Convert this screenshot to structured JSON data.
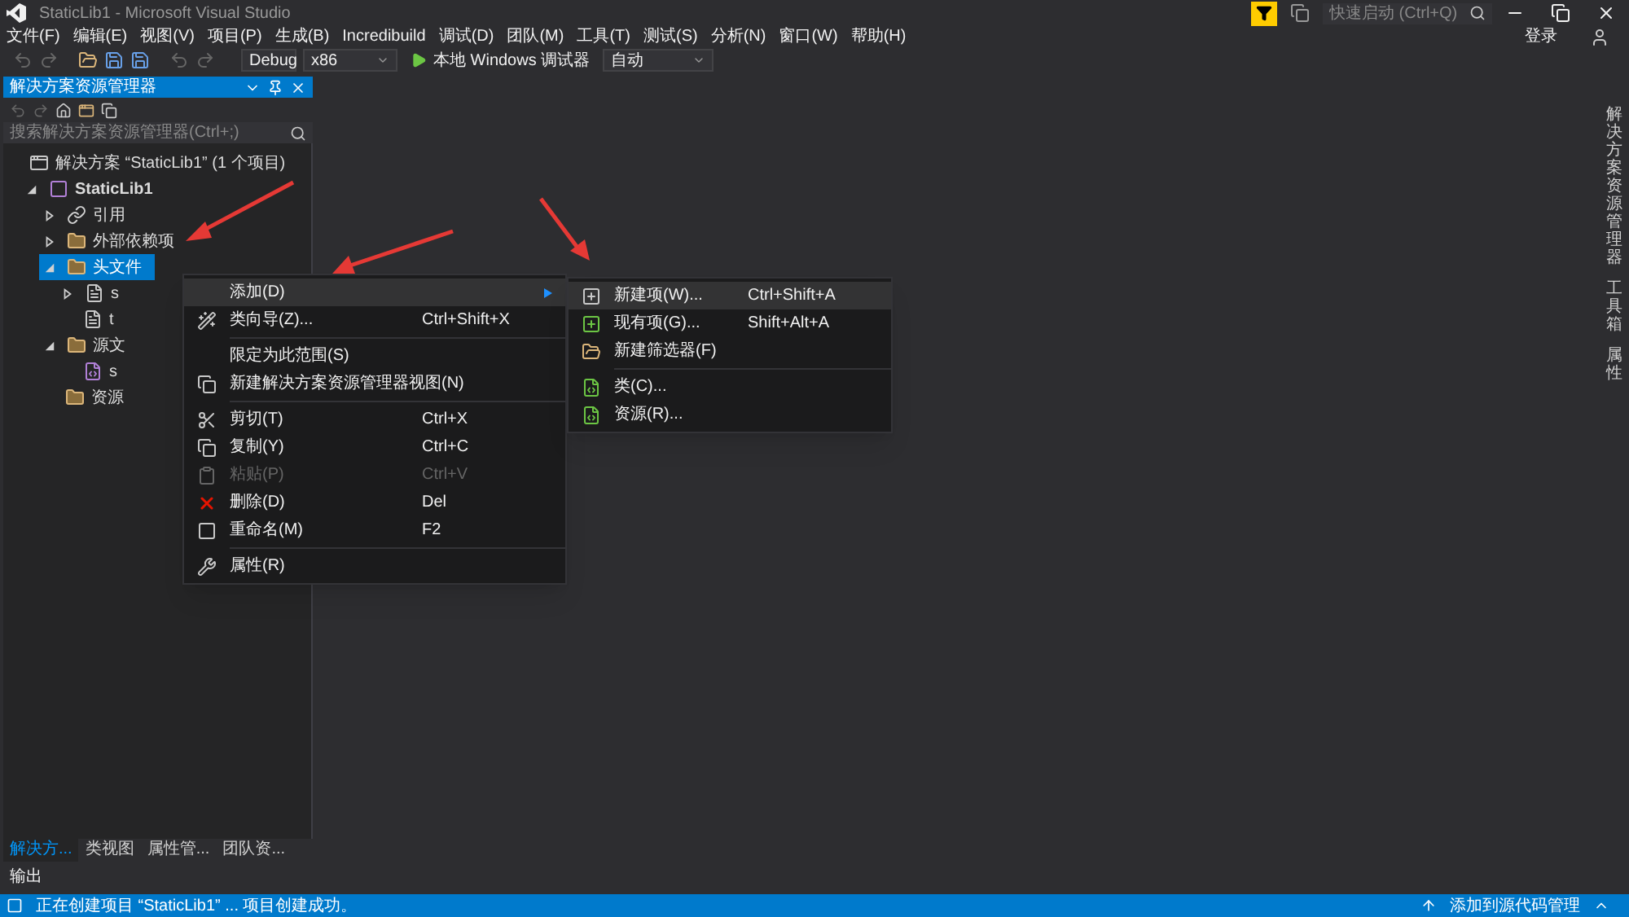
{
  "window": {
    "title": "StaticLib1 - Microsoft Visual Studio"
  },
  "menu_bar": [
    "文件(F)",
    "编辑(E)",
    "视图(V)",
    "项目(P)",
    "生成(B)",
    "Incredibuild",
    "调试(D)",
    "团队(M)",
    "工具(T)",
    "测试(S)",
    "分析(N)",
    "窗口(W)",
    "帮助(H)"
  ],
  "quick_launch": {
    "placeholder": "快速启动 (Ctrl+Q)"
  },
  "sign_in": "登录",
  "toolbar": {
    "configuration": "Debug",
    "platform": "x86",
    "run": "本地 Windows 调试器",
    "run_mode": "自动"
  },
  "solution_explorer": {
    "title": "解决方案资源管理器",
    "search": {
      "placeholder": "搜索解决方案资源管理器(Ctrl+;)"
    },
    "tree": [
      {
        "label": "解决方案 “StaticLib1” (1 个项目)",
        "kind": "solution",
        "selected": false,
        "children": [
          {
            "label": "StaticLib1",
            "kind": "project",
            "expanded": true,
            "selected": false,
            "children": [
              {
                "label": "引用",
                "kind": "references",
                "expanded": false,
                "selected": false
              },
              {
                "label": "外部依赖项",
                "kind": "folder",
                "expanded": false,
                "selected": false
              },
              {
                "label": "头文件",
                "kind": "folder",
                "expanded": true,
                "selected": true,
                "children": [
                  {
                    "label": "s",
                    "kind": "file",
                    "expanded": false,
                    "selected": false
                  },
                  {
                    "label": "t",
                    "kind": "file",
                    "selected": false
                  }
                ]
              },
              {
                "label": "源文",
                "kind": "folder",
                "expanded": true,
                "selected": false,
                "children": [
                  {
                    "label": "s",
                    "kind": "cpp",
                    "selected": false
                  }
                ]
              },
              {
                "label": "资源",
                "kind": "folder",
                "selected": false
              }
            ]
          }
        ]
      }
    ],
    "tabs": [
      {
        "label": "解决方...",
        "selected": true
      },
      {
        "label": "类视图",
        "selected": false
      },
      {
        "label": "属性管...",
        "selected": false
      },
      {
        "label": "团队资...",
        "selected": false
      }
    ]
  },
  "output_label": "输出",
  "right_tabs": [
    "解决方案资源管理器",
    "工具箱",
    "属性"
  ],
  "context_menu": [
    {
      "kind": "add",
      "label": "添加(D)",
      "submenu": true,
      "selected": true,
      "disabled": false
    },
    {
      "kind": "wizard",
      "label": "类向导(Z)...",
      "shortcut": "Ctrl+Shift+X",
      "selected": false,
      "disabled": false
    },
    {
      "kind": "separator"
    },
    {
      "kind": "scope",
      "label": "限定为此范围(S)",
      "selected": false,
      "disabled": false
    },
    {
      "kind": "windows",
      "label": "新建解决方案资源管理器视图(N)",
      "selected": false,
      "disabled": false
    },
    {
      "kind": "separator"
    },
    {
      "kind": "cut",
      "label": "剪切(T)",
      "shortcut": "Ctrl+X",
      "selected": false,
      "disabled": false
    },
    {
      "kind": "copy",
      "label": "复制(Y)",
      "shortcut": "Ctrl+C",
      "selected": false,
      "disabled": false
    },
    {
      "kind": "paste",
      "label": "粘贴(P)",
      "shortcut": "Ctrl+V",
      "selected": false,
      "disabled": true
    },
    {
      "kind": "delete",
      "label": "删除(D)",
      "shortcut": "Del",
      "selected": false,
      "disabled": false
    },
    {
      "kind": "rename",
      "label": "重命名(M)",
      "shortcut": "F2",
      "selected": false,
      "disabled": false
    },
    {
      "kind": "separator"
    },
    {
      "kind": "wrench",
      "label": "属性(R)",
      "selected": false,
      "disabled": false
    }
  ],
  "submenu": [
    {
      "kind": "new",
      "label": "新建项(W)...",
      "shortcut": "Ctrl+Shift+A",
      "selected": true
    },
    {
      "kind": "existing",
      "label": "现有项(G)...",
      "shortcut": "Shift+Alt+A",
      "selected": false
    },
    {
      "kind": "folder",
      "label": "新建筛选器(F)",
      "selected": false
    },
    {
      "kind": "separator"
    },
    {
      "kind": "class",
      "label": "类(C)...",
      "selected": false
    },
    {
      "kind": "class",
      "label": "资源(R)...",
      "selected": false
    }
  ],
  "status_bar": {
    "message": "正在创建项目 “StaticLib1” ... 项目创建成功。",
    "source_control": "添加到源代码管理"
  }
}
